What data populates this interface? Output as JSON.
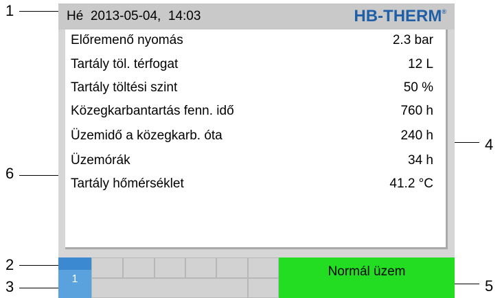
{
  "header": {
    "date_time": "Hé  2013-05-04,  14:03",
    "logo": "HB-THERM",
    "logo_mark": "®"
  },
  "rows": [
    {
      "label": "Előremenő nyomás",
      "value": "2.3 bar"
    },
    {
      "label": "Tartály töl. térfogat",
      "value": "12 L"
    },
    {
      "label": "Tartály töltési szint",
      "value": "50 %"
    },
    {
      "label": "Közegkarbantartás fenn. idő",
      "value": "760 h"
    },
    {
      "label": "Üzemidő a közegkarb. óta",
      "value": "240 h"
    },
    {
      "label": "Üzemórák",
      "value": "34 h"
    },
    {
      "label": "Tartály hőmérséklet",
      "value": "41.2 °C"
    }
  ],
  "footer": {
    "unit_number": "1",
    "status": "Normál üzem"
  },
  "callouts": [
    "1",
    "2",
    "3",
    "4",
    "5",
    "6"
  ],
  "colors": {
    "logo": "#1f5fa8",
    "status": "#22dd22",
    "unit": "#5aa2de"
  }
}
